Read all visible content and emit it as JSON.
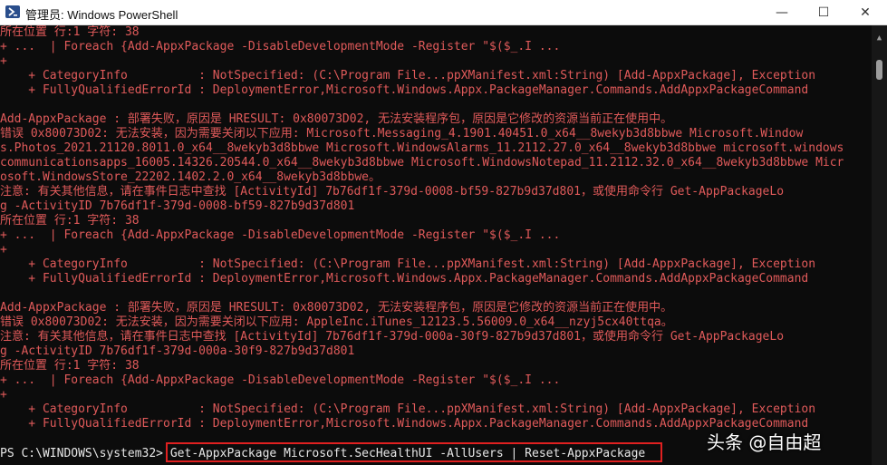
{
  "window": {
    "title": "管理员: Windows PowerShell",
    "min_glyph": "—",
    "max_glyph": "☐",
    "close_glyph": "✕"
  },
  "console": {
    "lines": [
      "所在位置 行:1 字符: 38",
      "+ ...  | Foreach {Add-AppxPackage -DisableDevelopmentMode -Register \"$($_.I ...",
      "+",
      "    + CategoryInfo          : NotSpecified: (C:\\Program File...ppXManifest.xml:String) [Add-AppxPackage], Exception",
      "    + FullyQualifiedErrorId : DeploymentError,Microsoft.Windows.Appx.PackageManager.Commands.AddAppxPackageCommand",
      "",
      "Add-AppxPackage : 部署失败，原因是 HRESULT: 0x80073D02, 无法安装程序包，原因是它修改的资源当前正在使用中。",
      "错误 0x80073D02: 无法安装，因为需要关闭以下应用: Microsoft.Messaging_4.1901.40451.0_x64__8wekyb3d8bbwe Microsoft.Window",
      "s.Photos_2021.21120.8011.0_x64__8wekyb3d8bbwe Microsoft.WindowsAlarms_11.2112.27.0_x64__8wekyb3d8bbwe microsoft.windows",
      "communicationsapps_16005.14326.20544.0_x64__8wekyb3d8bbwe Microsoft.WindowsNotepad_11.2112.32.0_x64__8wekyb3d8bbwe Micr",
      "osoft.WindowsStore_22202.1402.2.0_x64__8wekyb3d8bbwe。",
      "注意: 有关其他信息，请在事件日志中查找 [ActivityId] 7b76df1f-379d-0008-bf59-827b9d37d801，或使用命令行 Get-AppPackageLo",
      "g -ActivityID 7b76df1f-379d-0008-bf59-827b9d37d801",
      "所在位置 行:1 字符: 38",
      "+ ...  | Foreach {Add-AppxPackage -DisableDevelopmentMode -Register \"$($_.I ...",
      "+",
      "    + CategoryInfo          : NotSpecified: (C:\\Program File...ppXManifest.xml:String) [Add-AppxPackage], Exception",
      "    + FullyQualifiedErrorId : DeploymentError,Microsoft.Windows.Appx.PackageManager.Commands.AddAppxPackageCommand",
      "",
      "Add-AppxPackage : 部署失败，原因是 HRESULT: 0x80073D02, 无法安装程序包，原因是它修改的资源当前正在使用中。",
      "错误 0x80073D02: 无法安装，因为需要关闭以下应用: AppleInc.iTunes_12123.5.56009.0_x64__nzyj5cx40ttqa。",
      "注意: 有关其他信息，请在事件日志中查找 [ActivityId] 7b76df1f-379d-000a-30f9-827b9d37d801，或使用命令行 Get-AppPackageLo",
      "g -ActivityID 7b76df1f-379d-000a-30f9-827b9d37d801",
      "所在位置 行:1 字符: 38",
      "+ ...  | Foreach {Add-AppxPackage -DisableDevelopmentMode -Register \"$($_.I ...",
      "+",
      "    + CategoryInfo          : NotSpecified: (C:\\Program File...ppXManifest.xml:String) [Add-AppxPackage], Exception",
      "    + FullyQualifiedErrorId : DeploymentError,Microsoft.Windows.Appx.PackageManager.Commands.AddAppxPackageCommand",
      ""
    ],
    "prompt": "PS C:\\WINDOWS\\system32> Get-AppxPackage Microsoft.SecHealthUI -AllUsers | Reset-AppxPackage"
  },
  "watermark": "头条 @自由超",
  "colors": {
    "console_bg": "#0c0c0c",
    "error_text": "#e05a5a",
    "prompt_text": "#e6e6e6",
    "highlight_border": "#e02020"
  }
}
